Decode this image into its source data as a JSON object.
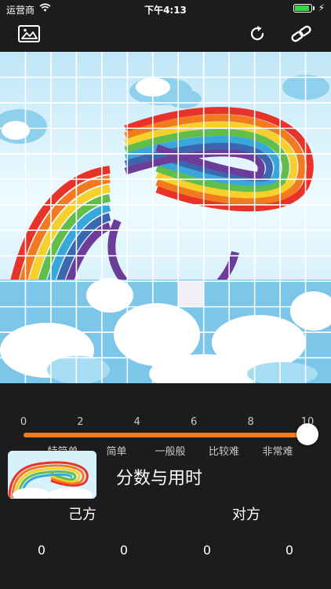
{
  "status": {
    "carrier": "运营商",
    "time": "下午4:13",
    "battery_level": 0.9
  },
  "toolbar": {
    "left_icon": "image-icon",
    "right_icons": [
      "refresh-icon",
      "link-icon"
    ]
  },
  "puzzle": {
    "grid_columns": 13,
    "grid_rows": 13
  },
  "slider": {
    "ticks": [
      "0",
      "2",
      "4",
      "6",
      "8",
      "10"
    ],
    "value": 10,
    "min": 0,
    "max": 10,
    "levels": [
      "特简单",
      "简单",
      "一般般",
      "比较难",
      "非常难"
    ],
    "track_color": "#f47a1f"
  },
  "score": {
    "title": "分数与用时",
    "self_label": "己方",
    "opponent_label": "对方",
    "values": [
      "0",
      "0",
      "0",
      "0"
    ]
  }
}
